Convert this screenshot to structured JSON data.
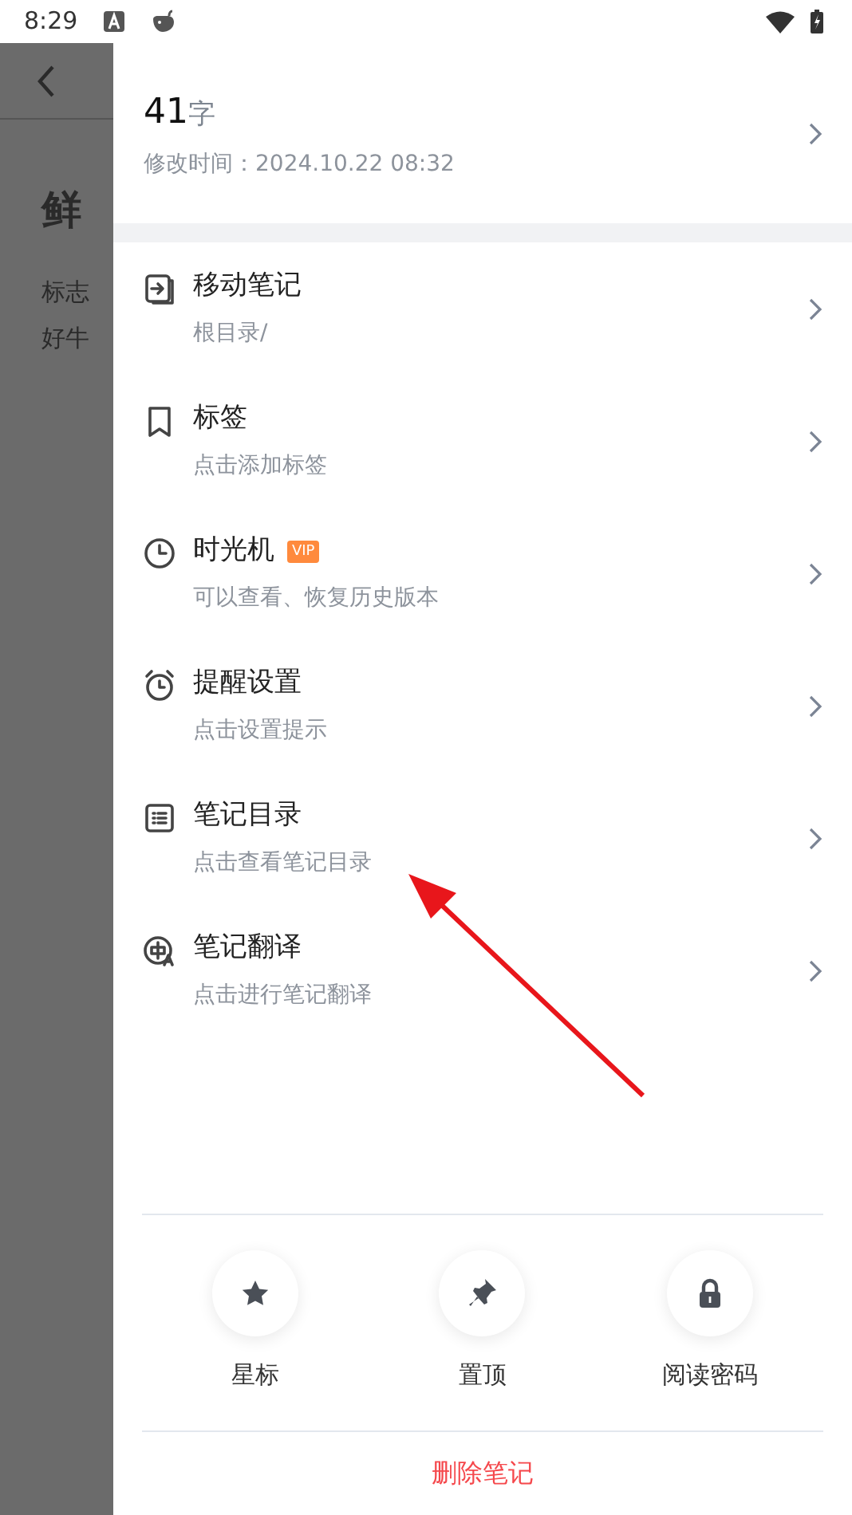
{
  "status_bar": {
    "time": "8:29"
  },
  "background_note": {
    "title": "鲜",
    "lines": [
      "标志",
      "好牛"
    ]
  },
  "summary": {
    "count": "41",
    "unit": "字",
    "modified": "修改时间：2024.10.22 08:32"
  },
  "items": [
    {
      "kind": "move",
      "title": "移动笔记",
      "subtitle": "根目录/"
    },
    {
      "kind": "tag",
      "title": "标签",
      "subtitle": "点击添加标签"
    },
    {
      "kind": "history",
      "title": "时光机",
      "badge": "VIP",
      "subtitle": "可以查看、恢复历史版本"
    },
    {
      "kind": "alarm",
      "title": "提醒设置",
      "subtitle": "点击设置提示"
    },
    {
      "kind": "outline",
      "title": "笔记目录",
      "subtitle": "点击查看笔记目录"
    },
    {
      "kind": "translate",
      "title": "笔记翻译",
      "subtitle": "点击进行笔记翻译"
    }
  ],
  "actions": [
    {
      "kind": "star",
      "label": "星标"
    },
    {
      "kind": "pin",
      "label": "置顶"
    },
    {
      "kind": "lock",
      "label": "阅读密码"
    }
  ],
  "delete_button": "删除笔记"
}
